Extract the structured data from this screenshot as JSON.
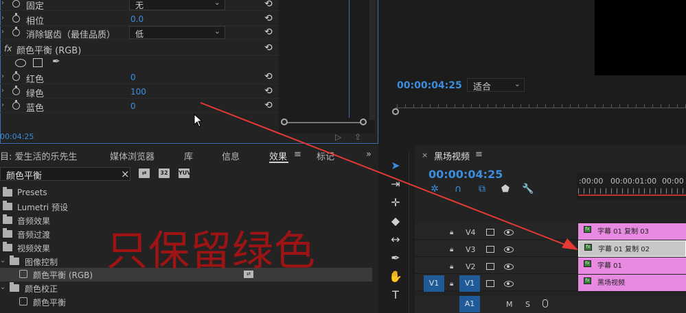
{
  "effect_controls": {
    "rows": [
      {
        "label": "固定",
        "dropdown": "无"
      },
      {
        "label": "相位",
        "value": "0.0"
      },
      {
        "label": "消除锯齿（最佳品质）",
        "dropdown": "低"
      },
      {
        "label": "颜色平衡 (RGB)"
      },
      {
        "label": "红色",
        "value": "0"
      },
      {
        "label": "绿色",
        "value": "100"
      },
      {
        "label": "蓝色",
        "value": "0"
      }
    ],
    "fx_badge": "fx",
    "timecode": "00:04:25"
  },
  "program_monitor": {
    "timecode": "00:00:04:25",
    "fit_dropdown": "适合"
  },
  "panel_tabs": [
    {
      "label": "目: 爱生活的乐先生"
    },
    {
      "label": "媒体浏览器"
    },
    {
      "label": "库"
    },
    {
      "label": "信息"
    },
    {
      "label": "效果"
    },
    {
      "label": "标记"
    }
  ],
  "effects_panel": {
    "search_value": "颜色平衡",
    "menu_glyph": "≡",
    "overflow_glyph": "»",
    "filter_buttons": [
      "32",
      "YUV"
    ],
    "tree": [
      {
        "label": "Presets"
      },
      {
        "label": "Lumetri 预设"
      },
      {
        "label": "音频效果"
      },
      {
        "label": "音频过渡"
      },
      {
        "label": "视频效果"
      },
      {
        "label": "图像控制"
      },
      {
        "label": "颜色平衡 (RGB)"
      },
      {
        "label": "颜色校正"
      },
      {
        "label": "颜色平衡"
      }
    ]
  },
  "annotation": {
    "caption": "只保留绿色",
    "color": "#9e1414"
  },
  "timeline": {
    "close": "×",
    "title": "黑场视频",
    "menu": "≡",
    "timecode": "00:00:04:25",
    "ruler_labels": [
      ":00:00",
      "00:00:01:00",
      "00:00"
    ],
    "tracks": [
      {
        "name": "V4"
      },
      {
        "name": "V3"
      },
      {
        "name": "V2"
      },
      {
        "name": "V1",
        "source": "V1"
      }
    ],
    "clips": [
      {
        "name": "字幕 01 复制 03"
      },
      {
        "name": "字幕 01 复制 02"
      },
      {
        "name": "字幕 01"
      },
      {
        "name": "黑场视频"
      }
    ],
    "audio": {
      "name": "A1",
      "m": "M",
      "s": "S"
    }
  },
  "colors": {
    "accent": "#3b8de0",
    "clip_pink": "#e889e2",
    "arrow_red": "#e53935",
    "caption_red": "#9e1414"
  },
  "icons": [
    "stopwatch-icon",
    "reset-icon",
    "ellipse-mask-icon",
    "rect-mask-icon",
    "pen-mask-icon",
    "folder-icon",
    "effect-icon",
    "selection-tool-icon",
    "track-select-tool-icon",
    "ripple-edit-tool-icon",
    "razor-tool-icon",
    "slip-tool-icon",
    "pen-tool-icon",
    "hand-tool-icon",
    "type-tool-icon",
    "lock-icon",
    "eye-icon",
    "film-icon",
    "microphone-icon"
  ]
}
